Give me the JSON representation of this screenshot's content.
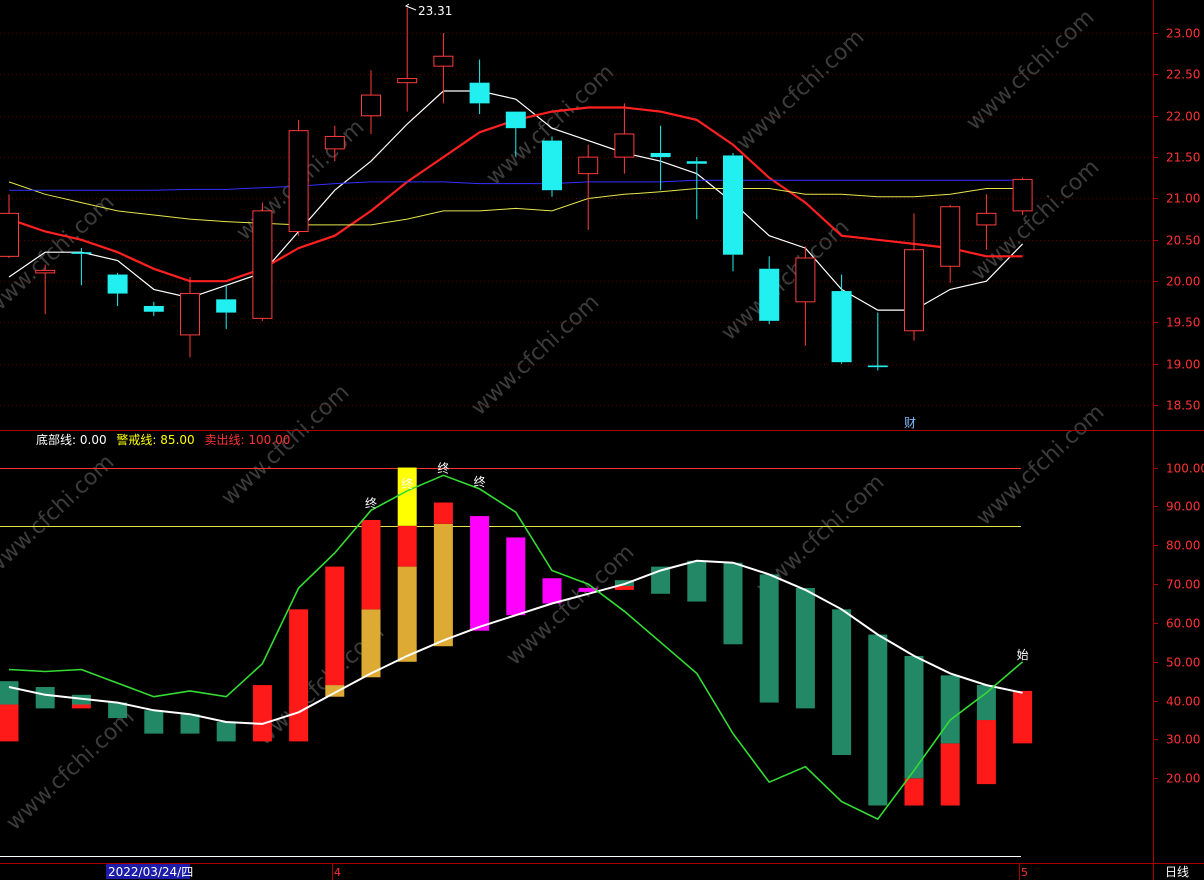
{
  "chart_data": [
    {
      "type": "candlestick",
      "y_ticks": [
        23.0,
        22.5,
        22.0,
        21.5,
        21.0,
        20.5,
        20.0,
        19.5,
        19.0,
        18.5
      ],
      "ylim": [
        18.2,
        23.4
      ],
      "grid": true,
      "annotations": {
        "high_label": "23.31",
        "event_marker": "财"
      },
      "candles": [
        {
          "open": 20.3,
          "close": 20.82,
          "high": 21.05,
          "low": 20.28
        },
        {
          "open": 20.1,
          "close": 20.13,
          "high": 20.2,
          "low": 19.6
        },
        {
          "open": 20.35,
          "close": 20.33,
          "high": 20.4,
          "low": 19.95
        },
        {
          "open": 20.08,
          "close": 19.85,
          "high": 20.1,
          "low": 19.7
        },
        {
          "open": 19.7,
          "close": 19.63,
          "high": 19.75,
          "low": 19.58
        },
        {
          "open": 19.35,
          "close": 19.85,
          "high": 20.05,
          "low": 19.08
        },
        {
          "open": 19.78,
          "close": 19.62,
          "high": 19.95,
          "low": 19.42
        },
        {
          "open": 19.55,
          "close": 20.85,
          "high": 20.95,
          "low": 19.52
        },
        {
          "open": 20.6,
          "close": 21.82,
          "high": 21.95,
          "low": 20.55
        },
        {
          "open": 21.6,
          "close": 21.75,
          "high": 21.88,
          "low": 21.45
        },
        {
          "open": 22.0,
          "close": 22.25,
          "high": 22.55,
          "low": 21.78
        },
        {
          "open": 22.4,
          "close": 22.45,
          "high": 23.31,
          "low": 22.05
        },
        {
          "open": 22.6,
          "close": 22.72,
          "high": 23.0,
          "low": 22.15
        },
        {
          "open": 22.4,
          "close": 22.15,
          "high": 22.68,
          "low": 22.02
        },
        {
          "open": 22.05,
          "close": 21.85,
          "high": 22.05,
          "low": 21.5
        },
        {
          "open": 21.7,
          "close": 21.1,
          "high": 21.75,
          "low": 21.02
        },
        {
          "open": 21.3,
          "close": 21.5,
          "high": 21.65,
          "low": 20.62
        },
        {
          "open": 21.5,
          "close": 21.78,
          "high": 22.15,
          "low": 21.3
        },
        {
          "open": 21.55,
          "close": 21.5,
          "high": 21.88,
          "low": 21.1
        },
        {
          "open": 21.45,
          "close": 21.42,
          "high": 21.5,
          "low": 20.75
        },
        {
          "open": 21.52,
          "close": 20.32,
          "high": 21.55,
          "low": 20.12
        },
        {
          "open": 20.15,
          "close": 19.52,
          "high": 20.3,
          "low": 19.48
        },
        {
          "open": 19.75,
          "close": 20.28,
          "high": 20.42,
          "low": 19.22
        },
        {
          "open": 19.88,
          "close": 19.02,
          "high": 20.08,
          "low": 19.0
        },
        {
          "open": 18.98,
          "close": 18.96,
          "high": 19.62,
          "low": 18.92
        },
        {
          "open": 19.4,
          "close": 20.38,
          "high": 20.82,
          "low": 19.28
        },
        {
          "open": 20.18,
          "close": 20.9,
          "high": 20.92,
          "low": 19.98
        },
        {
          "open": 20.68,
          "close": 20.82,
          "high": 21.05,
          "low": 20.38
        },
        {
          "open": 20.85,
          "close": 21.23,
          "high": 21.25,
          "low": 20.8
        }
      ],
      "series": [
        {
          "color": "#ffffff",
          "values": [
            20.05,
            20.35,
            20.35,
            20.25,
            19.9,
            19.8,
            19.95,
            20.1,
            20.6,
            21.1,
            21.45,
            21.9,
            22.3,
            22.3,
            22.2,
            21.85,
            21.7,
            21.55,
            21.45,
            21.3,
            20.95,
            20.55,
            20.4,
            19.9,
            19.65,
            19.65,
            19.9,
            20.0,
            20.45
          ]
        },
        {
          "color": "#ff2020",
          "values": [
            20.75,
            20.6,
            20.5,
            20.35,
            20.15,
            20.0,
            20.0,
            20.15,
            20.4,
            20.55,
            20.85,
            21.2,
            21.5,
            21.8,
            21.95,
            22.05,
            22.1,
            22.1,
            22.05,
            21.95,
            21.65,
            21.25,
            20.95,
            20.55,
            20.5,
            20.45,
            20.4,
            20.3,
            20.3
          ]
        },
        {
          "color": "#e6e64c",
          "values": [
            21.2,
            21.05,
            20.95,
            20.85,
            20.8,
            20.75,
            20.72,
            20.7,
            20.68,
            20.68,
            20.68,
            20.75,
            20.85,
            20.85,
            20.88,
            20.85,
            21.0,
            21.05,
            21.08,
            21.12,
            21.12,
            21.12,
            21.05,
            21.05,
            21.02,
            21.02,
            21.05,
            21.12,
            21.12
          ]
        },
        {
          "color": "#3030ff",
          "values": [
            21.1,
            21.1,
            21.1,
            21.1,
            21.1,
            21.11,
            21.11,
            21.13,
            21.15,
            21.18,
            21.2,
            21.2,
            21.2,
            21.18,
            21.18,
            21.18,
            21.2,
            21.2,
            21.2,
            21.22,
            21.22,
            21.22,
            21.22,
            21.22,
            21.22,
            21.22,
            21.22,
            21.22,
            21.22
          ]
        }
      ]
    },
    {
      "type": "bar",
      "y_ticks": [
        100.0,
        90.0,
        80.0,
        70.0,
        60.0,
        50.0,
        40.0,
        30.0,
        20.0
      ],
      "ylim": [
        0,
        104
      ],
      "grid": false,
      "legend": [
        {
          "label": "底部线:",
          "value": "0.00",
          "color": "#ffffff"
        },
        {
          "label": "警戒线:",
          "value": "85.00",
          "color": "#ffff00"
        },
        {
          "label": "卖出线:",
          "value": "100.00",
          "color": "#ff3333"
        }
      ],
      "reference_lines": [
        {
          "value": 100,
          "color": "#ff3333"
        },
        {
          "value": 85,
          "color": "#e6e64c"
        },
        {
          "value": 0,
          "color": "#ffffff"
        }
      ],
      "bars": [
        [
          {
            "bottom": 29.5,
            "top": 39.0,
            "color": "#ff1a1a"
          },
          {
            "bottom": 39.0,
            "top": 45.0,
            "color": "#228866"
          }
        ],
        [
          {
            "bottom": 38.0,
            "top": 43.5,
            "color": "#228866"
          }
        ],
        [
          {
            "bottom": 38.0,
            "top": 39.0,
            "color": "#ff1a1a"
          },
          {
            "bottom": 39.0,
            "top": 41.5,
            "color": "#228866"
          }
        ],
        [
          {
            "bottom": 35.5,
            "top": 39.5,
            "color": "#228866"
          }
        ],
        [
          {
            "bottom": 31.5,
            "top": 37.5,
            "color": "#228866"
          }
        ],
        [
          {
            "bottom": 31.5,
            "top": 36.5,
            "color": "#228866"
          }
        ],
        [
          {
            "bottom": 29.5,
            "top": 34.5,
            "color": "#228866"
          }
        ],
        [
          {
            "bottom": 29.5,
            "top": 44.0,
            "color": "#ff1a1a"
          }
        ],
        [
          {
            "bottom": 29.5,
            "top": 63.5,
            "color": "#ff1a1a"
          }
        ],
        [
          {
            "bottom": 41.0,
            "top": 44.0,
            "color": "#ddaa33"
          },
          {
            "bottom": 44.0,
            "top": 74.5,
            "color": "#ff1a1a"
          }
        ],
        [
          {
            "bottom": 46.0,
            "top": 63.5,
            "color": "#ddaa33"
          },
          {
            "bottom": 63.5,
            "top": 86.5,
            "color": "#ff1a1a"
          }
        ],
        [
          {
            "bottom": 50.0,
            "top": 74.5,
            "color": "#ddaa33"
          },
          {
            "bottom": 74.5,
            "top": 85.0,
            "color": "#ff1a1a"
          },
          {
            "bottom": 85.0,
            "top": 100.0,
            "color": "#ffff00"
          }
        ],
        [
          {
            "bottom": 54.0,
            "top": 85.5,
            "color": "#ddaa33"
          },
          {
            "bottom": 85.5,
            "top": 91.0,
            "color": "#ff1a1a"
          }
        ],
        [
          {
            "bottom": 58.0,
            "top": 87.5,
            "color": "#ff00ff"
          }
        ],
        [
          {
            "bottom": 62.0,
            "top": 82.0,
            "color": "#ff00ff"
          }
        ],
        [
          {
            "bottom": 65.0,
            "top": 71.5,
            "color": "#ff00ff"
          }
        ],
        [
          {
            "bottom": 68.0,
            "top": 69.0,
            "color": "#ff00ff"
          }
        ],
        [
          {
            "bottom": 68.5,
            "top": 69.5,
            "color": "#ff1a1a"
          },
          {
            "bottom": 69.5,
            "top": 71.0,
            "color": "#228866"
          }
        ],
        [
          {
            "bottom": 67.5,
            "top": 74.5,
            "color": "#228866"
          }
        ],
        [
          {
            "bottom": 65.5,
            "top": 76.0,
            "color": "#228866"
          }
        ],
        [
          {
            "bottom": 54.5,
            "top": 75.5,
            "color": "#228866"
          }
        ],
        [
          {
            "bottom": 39.5,
            "top": 72.5,
            "color": "#228866"
          }
        ],
        [
          {
            "bottom": 38.0,
            "top": 69.0,
            "color": "#228866"
          }
        ],
        [
          {
            "bottom": 26.0,
            "top": 63.5,
            "color": "#228866"
          }
        ],
        [
          {
            "bottom": 13.0,
            "top": 57.0,
            "color": "#228866"
          }
        ],
        [
          {
            "bottom": 13.0,
            "top": 20.0,
            "color": "#ff1a1a"
          },
          {
            "bottom": 20.0,
            "top": 51.5,
            "color": "#228866"
          }
        ],
        [
          {
            "bottom": 13.0,
            "top": 29.0,
            "color": "#ff1a1a"
          },
          {
            "bottom": 29.0,
            "top": 46.5,
            "color": "#228866"
          }
        ],
        [
          {
            "bottom": 18.5,
            "top": 35.0,
            "color": "#ff1a1a"
          },
          {
            "bottom": 35.0,
            "top": 44.0,
            "color": "#228866"
          }
        ],
        [
          {
            "bottom": 29.0,
            "top": 42.5,
            "color": "#ff1a1a"
          }
        ]
      ],
      "series": [
        {
          "color": "#ffffff",
          "values": [
            43.5,
            41.5,
            40.5,
            39.5,
            37.5,
            36.5,
            34.5,
            34.0,
            37.0,
            42.0,
            47.0,
            51.5,
            55.5,
            59.0,
            62.0,
            65.0,
            67.5,
            70.0,
            73.5,
            76.0,
            75.5,
            72.5,
            68.5,
            63.5,
            57.0,
            51.5,
            47.0,
            44.0,
            42.0
          ]
        },
        {
          "color": "#33dd33",
          "values": [
            48.0,
            47.5,
            48.0,
            44.5,
            41.0,
            42.5,
            41.0,
            49.5,
            69.0,
            78.0,
            89.0,
            94.0,
            98.0,
            94.5,
            88.5,
            73.5,
            70.0,
            63.0,
            55.0,
            47.0,
            31.5,
            19.0,
            23.0,
            14.0,
            9.5,
            22.0,
            35.0,
            42.0,
            50.0
          ]
        }
      ],
      "annotations": [
        {
          "text": "终",
          "index": 10
        },
        {
          "text": "终",
          "index": 11
        },
        {
          "text": "终",
          "index": 12
        },
        {
          "text": "终",
          "index": 13
        },
        {
          "text": "始",
          "index": 28
        }
      ]
    }
  ],
  "status_bar": {
    "date": "2022/03/24/四",
    "month_markers": [
      "4",
      "5"
    ],
    "period": "日线"
  },
  "watermark": "www.cfchi.com"
}
